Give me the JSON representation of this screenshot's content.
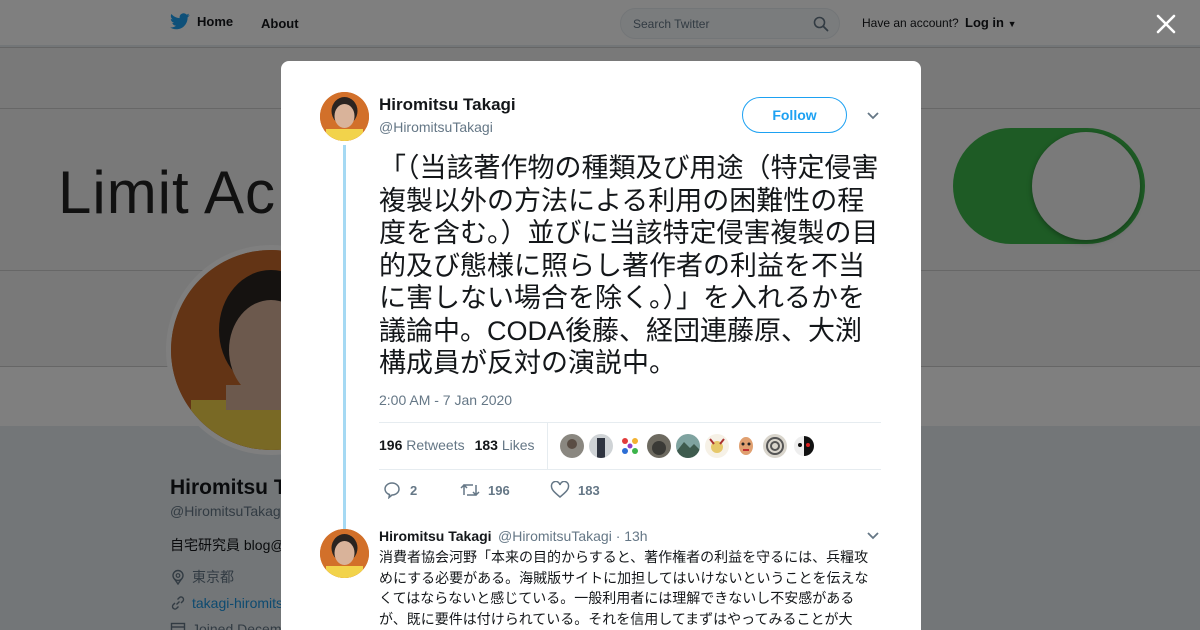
{
  "topbar": {
    "home_label": "Home",
    "about_label": "About",
    "search_placeholder": "Search Twitter",
    "have_account": "Have an account?",
    "login_label": "Log in"
  },
  "banner": {
    "text": "Limit Ac"
  },
  "profile": {
    "name": "Hiromitsu T",
    "handle": "@HiromitsuTakag",
    "bio": "自宅研究員 blog@",
    "location": "東京都",
    "url": "takagi-hiromits",
    "joined": "Joined Decem"
  },
  "tweet": {
    "name": "Hiromitsu Takagi",
    "handle": "@HiromitsuTakagi",
    "follow_label": "Follow",
    "text": "「（当該著作物の種類及び用途（特定侵害複製以外の方法による利用の困難性の程度を含む。）並びに当該特定侵害複製の目的及び態様に照らし著作者の利益を不当に害しない場合を除く。）」を入れるかを議論中。CODA後藤、経団連藤原、大渕構成員が反対の演説中。",
    "timestamp": "2:00 AM - 7 Jan 2020",
    "retweets_count": "196",
    "retweets_label": "Retweets",
    "likes_count": "183",
    "likes_label": "Likes",
    "reply_count": "2",
    "retweet_action_count": "196",
    "like_action_count": "183"
  },
  "reply": {
    "name": "Hiromitsu Takagi",
    "meta": "@HiromitsuTakagi · 13h",
    "text": "消費者協会河野「本来の目的からすると、著作権者の利益を守るには、兵糧攻めにする必要がある。海賊版サイトに加担してはいけないということを伝えなくてはならないと感じている。一般利用者には理解できないし不安感があるが、既に要件は付けられている。それを信用してまずはやってみることが大"
  },
  "colors": {
    "accent": "#1da1f2",
    "thread_line": "#a5d9f3",
    "toggle_green": "#3cb74a"
  }
}
